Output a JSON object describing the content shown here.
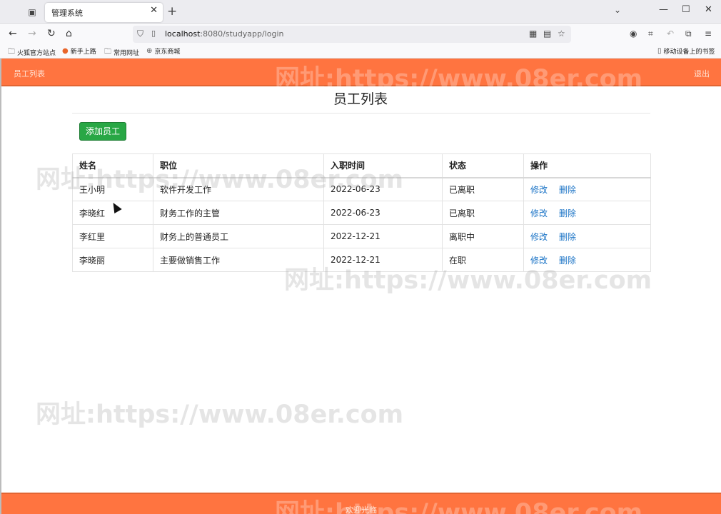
{
  "browser": {
    "tab_title": "管理系统",
    "url_host": "localhost",
    "url_rest": ":8080/studyapp/login",
    "bookmarks": [
      "火狐官方站点",
      "新手上路",
      "常用网址",
      "京东商城"
    ],
    "mobile_bookmarks": "移动设备上的书签"
  },
  "header": {
    "title": "员工列表",
    "logout": "退出"
  },
  "main": {
    "title": "员工列表",
    "add_button": "添加员工",
    "columns": [
      "姓名",
      "职位",
      "入职时间",
      "状态",
      "操作"
    ],
    "rows": [
      {
        "name": "王小明",
        "position": "软件开发工作",
        "date": "2022-06-23",
        "status": "已离职"
      },
      {
        "name": "李晓红",
        "position": "财务工作的主管",
        "date": "2022-06-23",
        "status": "已离职"
      },
      {
        "name": "李红里",
        "position": "财务上的普通员工",
        "date": "2022-12-21",
        "status": "离职中"
      },
      {
        "name": "李晓丽",
        "position": "主要做销售工作",
        "date": "2022-12-21",
        "status": "在职"
      }
    ],
    "edit_label": "修改",
    "delete_label": "删除"
  },
  "footer": {
    "text": "欢迎光临"
  },
  "watermark": "网址:https://www.08er.com",
  "colors": {
    "header_bg": "#ff7440",
    "add_button_bg": "#28a745",
    "link": "#1a73c6"
  }
}
